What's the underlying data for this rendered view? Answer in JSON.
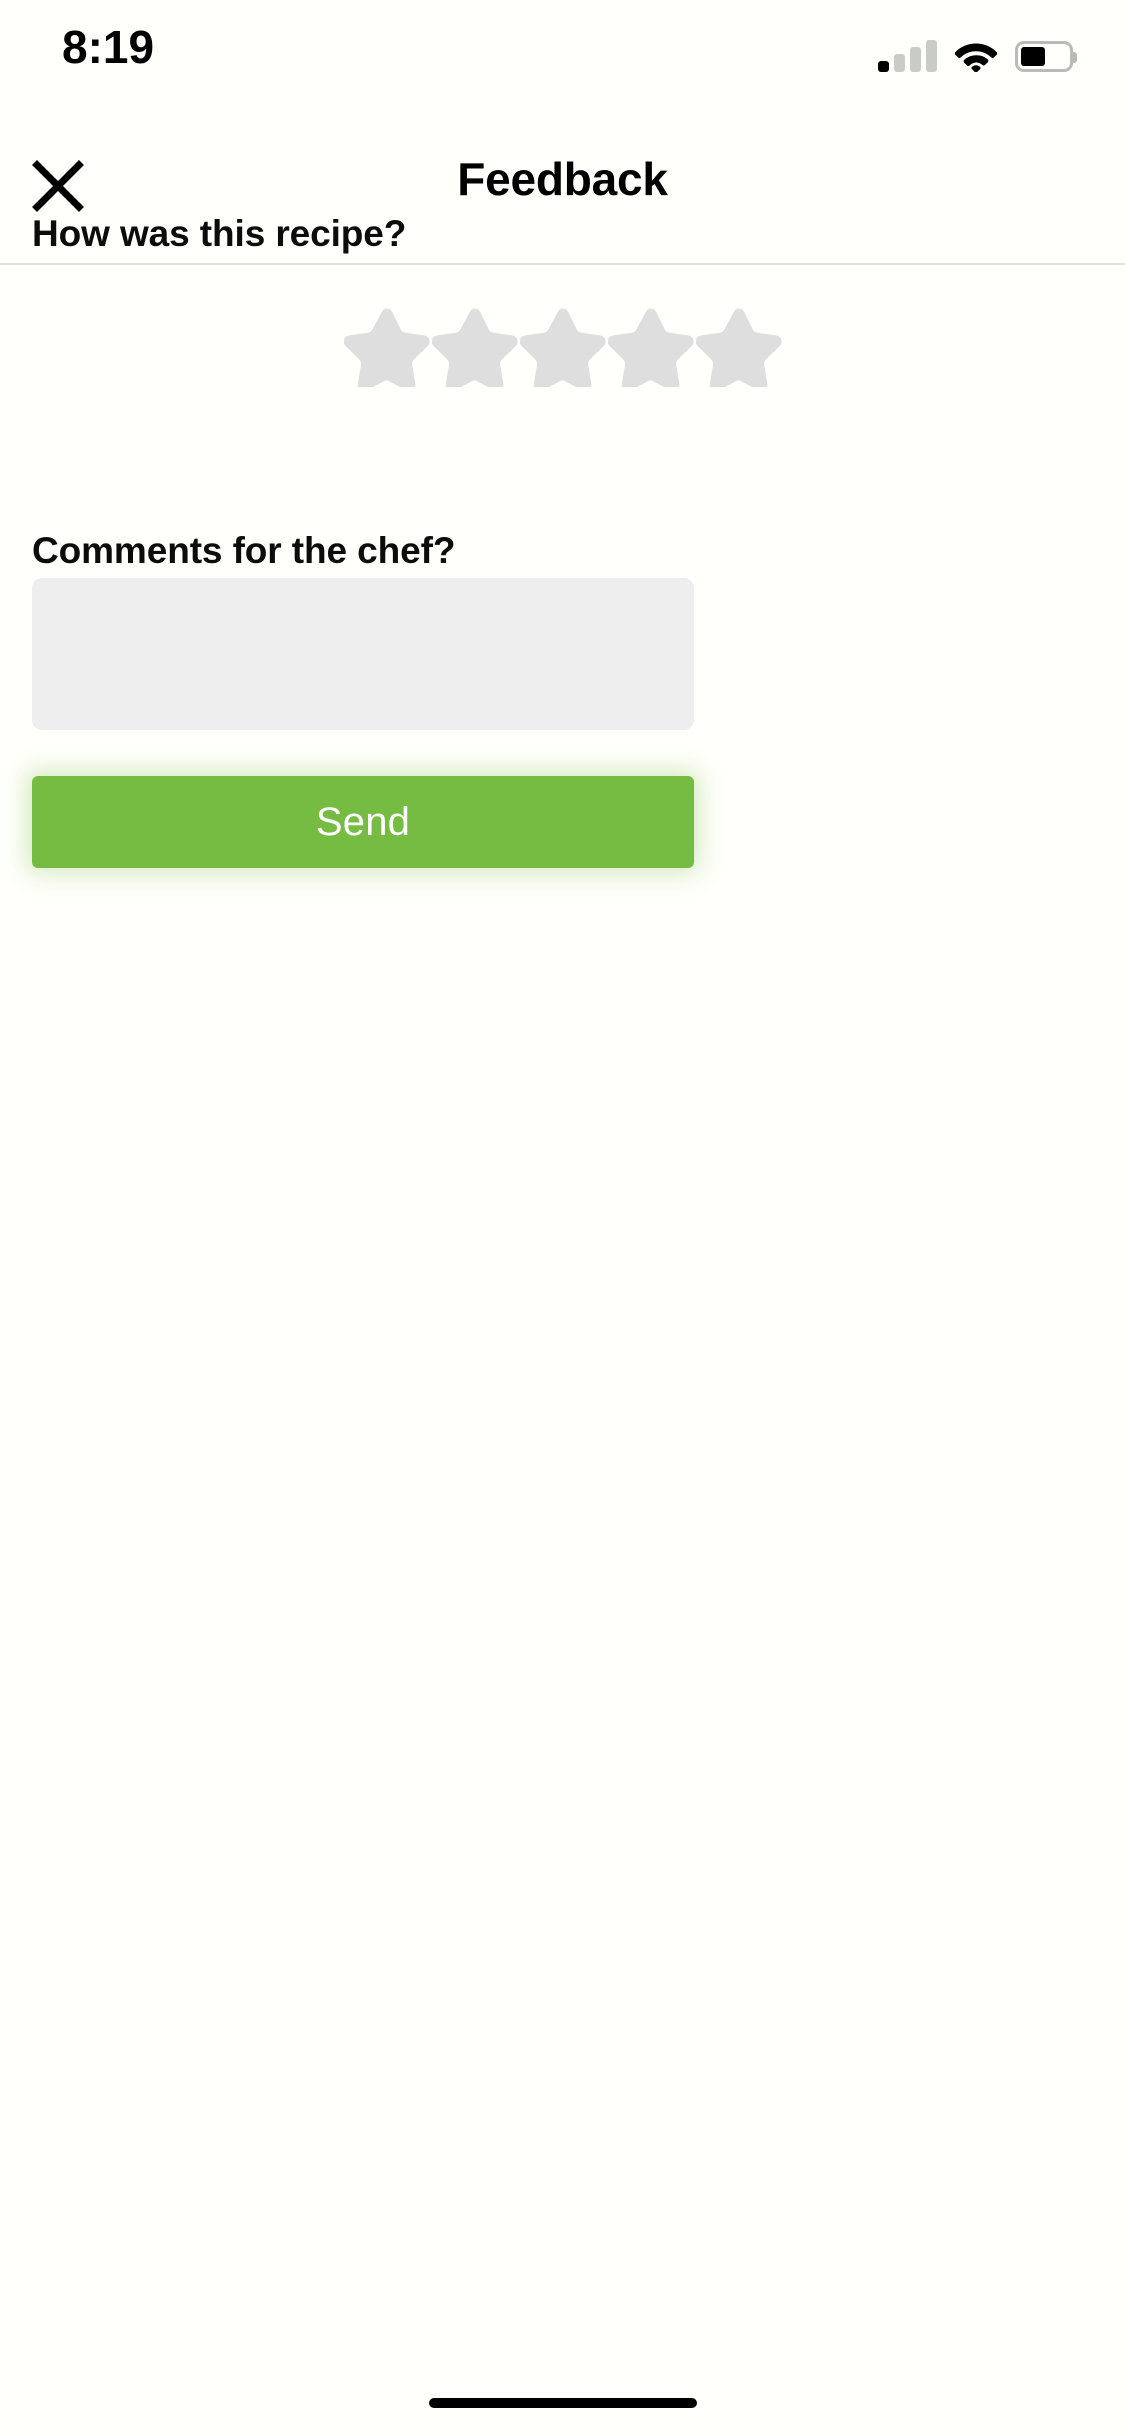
{
  "status_bar": {
    "time": "8:19",
    "cellular_icon": "signal-bars-icon",
    "cellular_bars_active": 1,
    "cellular_bars_total": 4,
    "wifi_icon": "wifi-icon",
    "battery_icon": "battery-icon",
    "battery_level_percent": 52
  },
  "header": {
    "close_icon": "close-x-icon",
    "title": "Feedback"
  },
  "main": {
    "rating_label": "How was this recipe?",
    "rating": {
      "value": 0,
      "max": 5,
      "star_icon": "star-icon",
      "empty_color": "#dededf",
      "filled_color": "#f5c518"
    },
    "comments_label": "Comments for the chef?",
    "comments_value": "",
    "comments_placeholder": "",
    "send_label": "Send",
    "send_color": "#76bb42"
  },
  "home_indicator": "home-indicator"
}
